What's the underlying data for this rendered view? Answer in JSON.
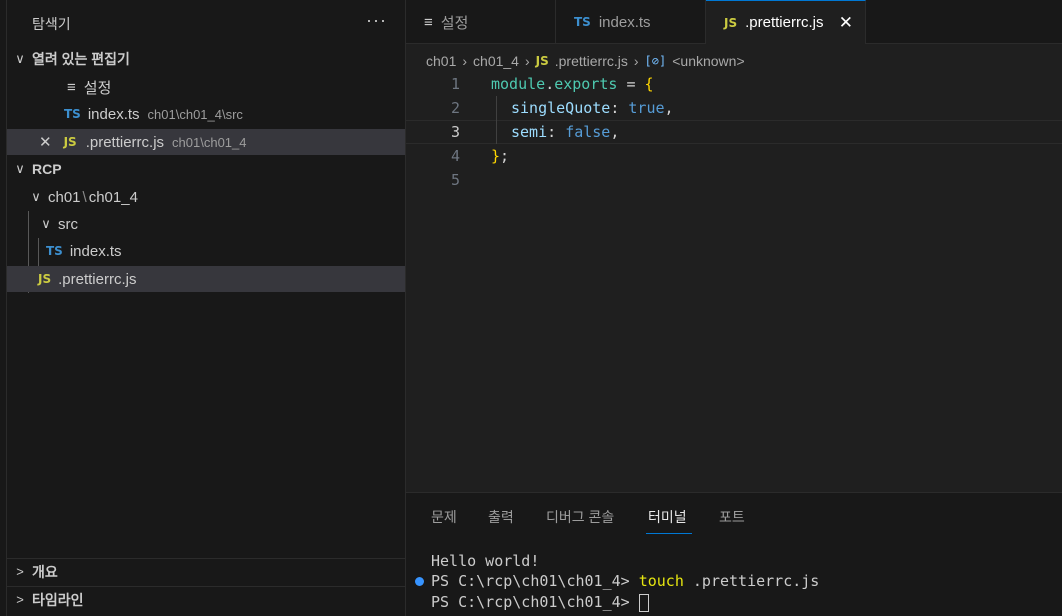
{
  "sidebar": {
    "title": "탐색기",
    "more_label": "···",
    "open_editors": {
      "title": "열려 있는 편집기",
      "items": [
        {
          "icon": "≡",
          "name": "설정",
          "desc": ""
        },
        {
          "icon": "TS",
          "name": "index.ts",
          "desc": "ch01\\ch01_4\\src"
        },
        {
          "icon": "JS",
          "name": ".prettierrc.js",
          "desc": "ch01\\ch01_4",
          "close": "✕"
        }
      ]
    },
    "project": {
      "title": "RCP",
      "folder_path_1": "ch01",
      "folder_path_sep": "\\",
      "folder_path_2": "ch01_4",
      "subfolder": "src",
      "files": [
        {
          "icon": "TS",
          "name": "index.ts"
        },
        {
          "icon": "JS",
          "name": ".prettierrc.js"
        }
      ]
    },
    "outline_title": "개요",
    "timeline_title": "타임라인"
  },
  "tabs": [
    {
      "icon": "≡",
      "label": "설정"
    },
    {
      "icon": "TS",
      "label": "index.ts"
    },
    {
      "icon": "JS",
      "label": ".prettierrc.js",
      "close": "✕"
    }
  ],
  "breadcrumb": {
    "parts": [
      "ch01",
      "ch01_4"
    ],
    "file_icon": "JS",
    "file": ".prettierrc.js",
    "symbol_icon": "[⊘]",
    "symbol": "<unknown>"
  },
  "editor": {
    "line_numbers": [
      "1",
      "2",
      "3",
      "4",
      "5"
    ],
    "lines": [
      {
        "t1": "module",
        "t2": ".",
        "t3": "exports",
        "t4": " = ",
        "t5": "{"
      },
      {
        "t1": "singleQuote",
        "t2": ": ",
        "t3": "true",
        "t4": ","
      },
      {
        "t1": "semi",
        "t2": ": ",
        "t3": "false",
        "t4": ","
      },
      {
        "t1": "}",
        "t2": ";"
      }
    ]
  },
  "panel": {
    "tabs": [
      "문제",
      "출력",
      "디버그 콘솔",
      "터미널",
      "포트"
    ],
    "terminal": {
      "line1": "Hello world!",
      "prompt": "PS C:\\rcp\\ch01\\ch01_4> ",
      "cmd": "touch",
      "arg": " .prettierrc.js"
    }
  }
}
